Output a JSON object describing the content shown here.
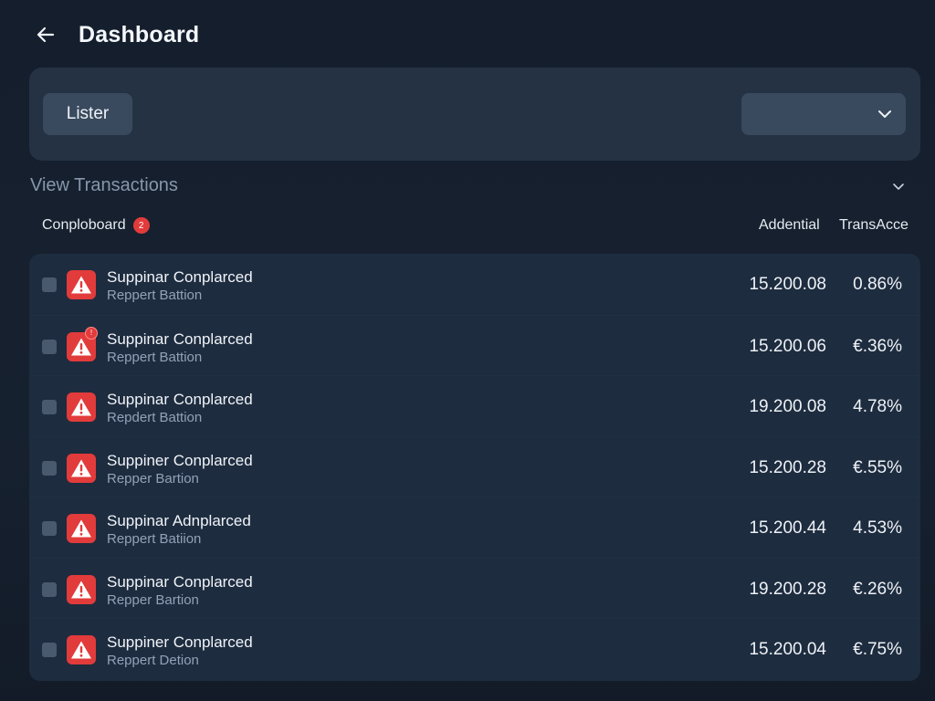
{
  "header": {
    "title": "Dashboard",
    "back_icon": "arrow-left-icon"
  },
  "filter": {
    "lister_label": "Lister",
    "select_value": ""
  },
  "section": {
    "title": "View Transactions"
  },
  "columns": {
    "name": "Conploboard",
    "badge": "2",
    "amount": "Addential",
    "percent": "TransAcce"
  },
  "rows": [
    {
      "title": "Suppinar Conplarced",
      "subtitle": "Reppert Battion",
      "amount": "15.200.08",
      "percent": "0.86%",
      "badge": ""
    },
    {
      "title": "Suppinar Conplarced",
      "subtitle": "Reppert Battion",
      "amount": "15.200.06",
      "percent": "€.36%",
      "badge": "!"
    },
    {
      "title": "Suppinar Conplarced",
      "subtitle": "Repdert Battion",
      "amount": "19.200.08",
      "percent": "4.78%",
      "badge": ""
    },
    {
      "title": "Suppiner Conplarced",
      "subtitle": "Repper Bartion",
      "amount": "15.200.28",
      "percent": "€.55%",
      "badge": ""
    },
    {
      "title": "Suppinar Adnplarced",
      "subtitle": "Reppert Batiion",
      "amount": "15.200.44",
      "percent": "4.53%",
      "badge": ""
    },
    {
      "title": "Suppinar Conplarced",
      "subtitle": "Repper Bartion",
      "amount": "19.200.28",
      "percent": "€.26%",
      "badge": ""
    },
    {
      "title": "Suppiner Conplarced",
      "subtitle": "Reppert Detion",
      "amount": "15.200.04",
      "percent": "€.75%",
      "badge": ""
    }
  ],
  "colors": {
    "accent_red": "#e23b3b",
    "panel": "#243244",
    "table_bg": "#1e2c3f"
  }
}
